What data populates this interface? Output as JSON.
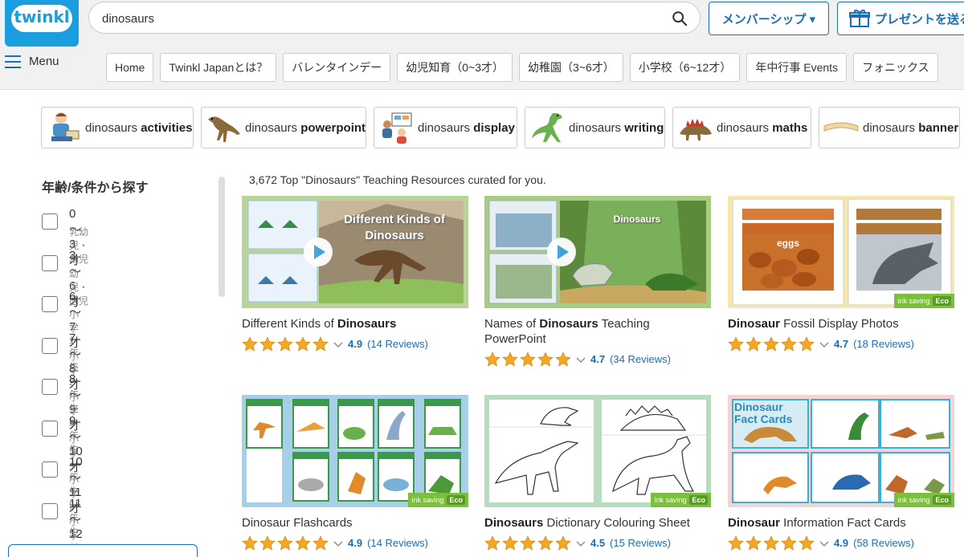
{
  "header": {
    "logo_text": "twinkl",
    "search_value": "dinosaurs",
    "member_button": "メンバーシップ ▾",
    "gift_button": "プレゼントを送る",
    "menu_label": "Menu"
  },
  "nav": [
    "Home",
    "Twinkl Japanとは？",
    "バレンタインデー",
    "幼児知育（0~3才）",
    "幼稚園（3~6才）",
    "小学校（6~12才）",
    "年中行事 Events",
    "フォニックス"
  ],
  "chips": [
    {
      "prefix": "dinosaurs",
      "bold": "activities"
    },
    {
      "prefix": "dinosaurs",
      "bold": "powerpoint"
    },
    {
      "prefix": "dinosaurs",
      "bold": "display"
    },
    {
      "prefix": "dinosaurs",
      "bold": "writing"
    },
    {
      "prefix": "dinosaurs",
      "bold": "maths"
    },
    {
      "prefix": "dinosaurs",
      "bold": "banner"
    }
  ],
  "sidebar": {
    "title": "年齢/条件から探す",
    "filters": [
      {
        "label": "0～3才",
        "sub": "乳幼児・幼児"
      },
      {
        "label": "3～6才",
        "sub": "幼児・園児"
      },
      {
        "label": "6～7才",
        "sub": "小学1年生"
      },
      {
        "label": "7～8才",
        "sub": "小学2年生"
      },
      {
        "label": "8～9才",
        "sub": "小学3年生"
      },
      {
        "label": "9～10才",
        "sub": "小学4年生"
      },
      {
        "label": "10～11才",
        "sub": "小学5年生"
      },
      {
        "label": "11～12才",
        "sub": "小学6年生"
      }
    ]
  },
  "results": {
    "count_text": "3,672 Top \"Dinosaurs\" Teaching Resources curated for you.",
    "cards": [
      {
        "title_pre": "Different Kinds of ",
        "title_bold": "Dinosaurs",
        "title_post": "",
        "rating": "4.9",
        "reviews": "(14 Reviews)",
        "thumb_text": "Different Kinds of Dinosaurs"
      },
      {
        "title_pre": "Names of ",
        "title_bold": "Dinosaurs",
        "title_post": " Teaching PowerPoint",
        "rating": "4.7",
        "reviews": "(34 Reviews)",
        "thumb_text": "Dinosaurs"
      },
      {
        "title_pre": "",
        "title_bold": "Dinosaur",
        "title_post": " Fossil Display Photos",
        "rating": "4.7",
        "reviews": "(18 Reviews)",
        "thumb_text": "eggs"
      },
      {
        "title_pre": "",
        "title_bold": "",
        "title_post": "Dinosaur Flashcards",
        "rating": "4.9",
        "reviews": "(14 Reviews)",
        "thumb_text": ""
      },
      {
        "title_pre": "",
        "title_bold": "Dinosaurs",
        "title_post": " Dictionary Colouring Sheet",
        "rating": "4.5",
        "reviews": "(15 Reviews)",
        "thumb_text": ""
      },
      {
        "title_pre": "",
        "title_bold": "Dinosaur",
        "title_post": " Information Fact Cards",
        "rating": "4.9",
        "reviews": "(58 Reviews)",
        "thumb_text": "Dinosaur Fact Cards"
      }
    ],
    "eco_label": "ink saving",
    "eco_badge": "Eco"
  },
  "colors": {
    "brand": "#1a9ee0",
    "link": "#1a6fb5",
    "star": "#f5a623",
    "eco": "#7cbf3f"
  }
}
